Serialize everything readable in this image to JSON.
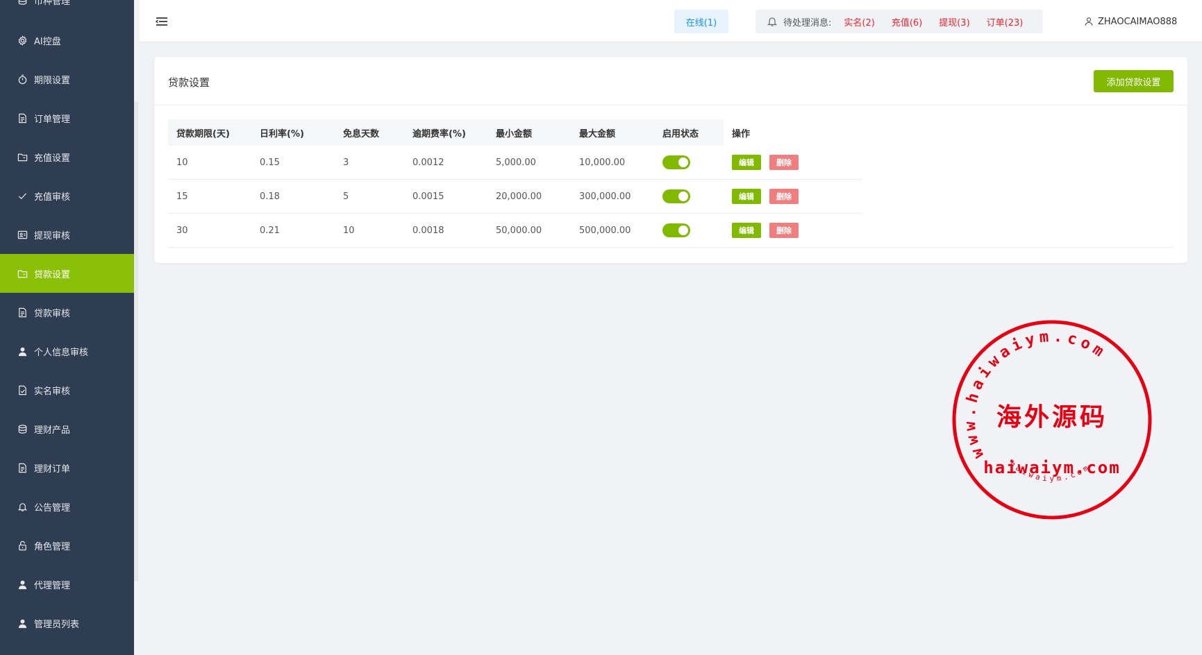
{
  "sidebar": {
    "items": [
      {
        "label": "币种管理",
        "icon": "database-icon"
      },
      {
        "label": "AI控盘",
        "icon": "gear-icon"
      },
      {
        "label": "期限设置",
        "icon": "timer-icon"
      },
      {
        "label": "订单管理",
        "icon": "document-icon"
      },
      {
        "label": "充值设置",
        "icon": "folder-icon"
      },
      {
        "label": "充值审核",
        "icon": "check-icon"
      },
      {
        "label": "提现审核",
        "icon": "id-card-icon"
      },
      {
        "label": "贷款设置",
        "icon": "folder-icon"
      },
      {
        "label": "贷款审核",
        "icon": "document-icon"
      },
      {
        "label": "个人信息审核",
        "icon": "user-icon"
      },
      {
        "label": "实名审核",
        "icon": "document-check-icon"
      },
      {
        "label": "理财产品",
        "icon": "database-icon"
      },
      {
        "label": "理财订单",
        "icon": "document-icon"
      },
      {
        "label": "公告管理",
        "icon": "bell-icon"
      },
      {
        "label": "角色管理",
        "icon": "lock-icon"
      },
      {
        "label": "代理管理",
        "icon": "user-icon"
      },
      {
        "label": "管理员列表",
        "icon": "user-icon"
      }
    ],
    "active_index": 7,
    "active_color": "#8ac007",
    "bg_color": "#2f3d52"
  },
  "header": {
    "online_label": "在线(1)",
    "pending_label": "待处理消息:",
    "pending_links": [
      "实名(2)",
      "充值(6)",
      "提现(3)",
      "订单(23)"
    ],
    "username": "ZHAOCAIMAO888"
  },
  "card": {
    "title": "贷款设置",
    "add_button": "添加贷款设置",
    "columns": [
      "贷款期限(天)",
      "日利率(%)",
      "免息天数",
      "逾期费率(%)",
      "最小金额",
      "最大金额",
      "启用状态",
      "操作"
    ],
    "rows": [
      {
        "term": "10",
        "rate": "0.15",
        "free_days": "3",
        "overdue_rate": "0.0012",
        "min": "5,000.00",
        "max": "10,000.00",
        "enabled": true
      },
      {
        "term": "15",
        "rate": "0.18",
        "free_days": "5",
        "overdue_rate": "0.0015",
        "min": "20,000.00",
        "max": "300,000.00",
        "enabled": true
      },
      {
        "term": "30",
        "rate": "0.21",
        "free_days": "10",
        "overdue_rate": "0.0018",
        "min": "50,000.00",
        "max": "500,000.00",
        "enabled": true
      }
    ],
    "edit_label": "编辑",
    "delete_label": "删除"
  },
  "watermark": {
    "center_text": "海外源码",
    "domain_text": "haiwaiym.com",
    "ring_text": "www.haiwaiym.com",
    "small_ring_text": "haiwaiym.com",
    "color": "#e60012"
  }
}
